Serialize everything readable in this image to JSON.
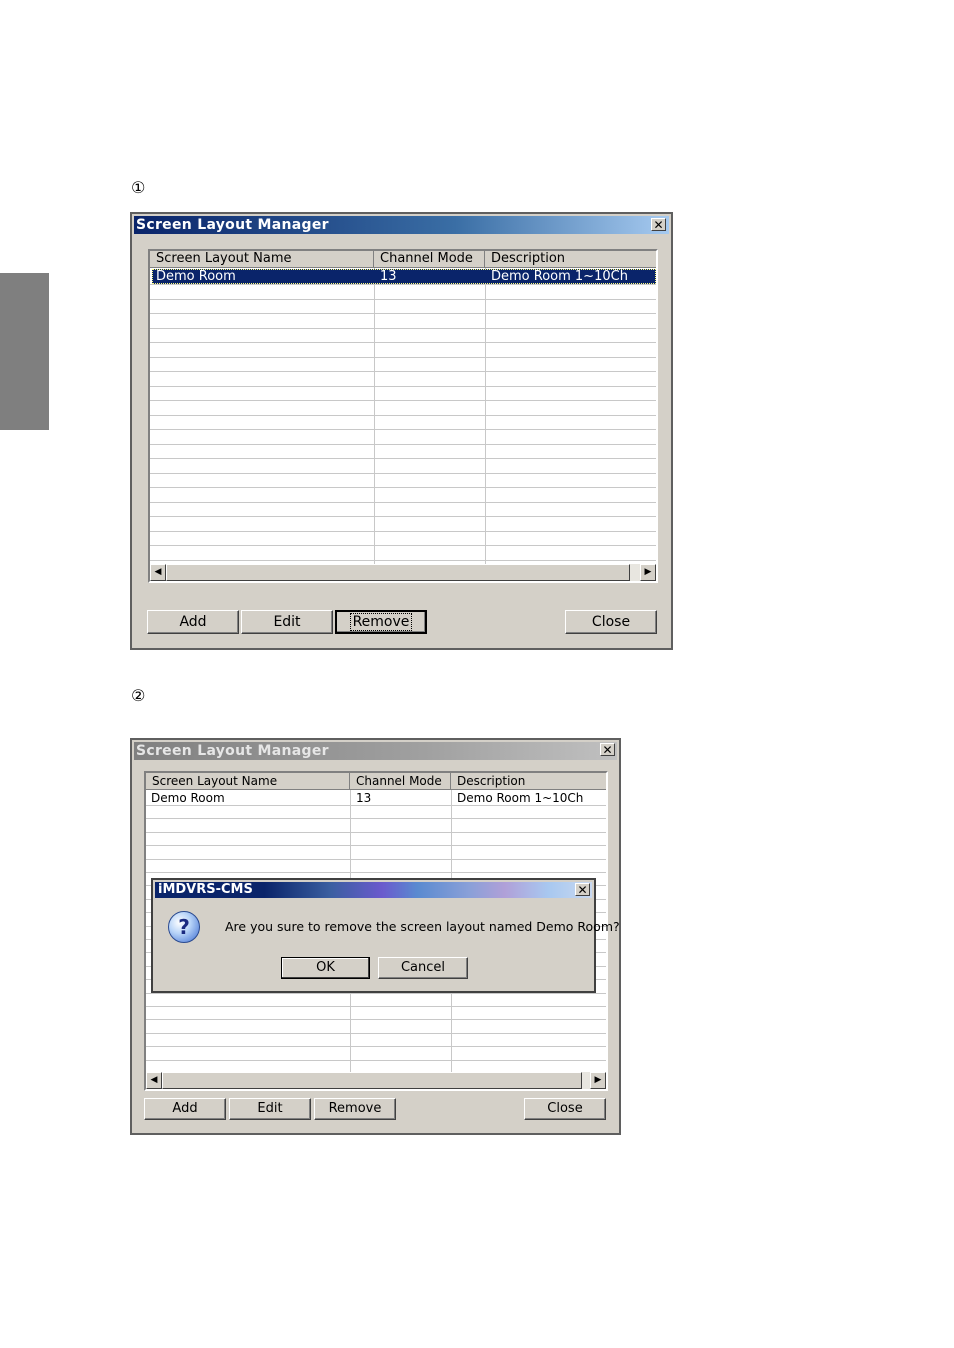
{
  "steps": {
    "step1": "①",
    "step2": "②"
  },
  "window1": {
    "title": "Screen Layout Manager",
    "columns": [
      "Screen Layout Name",
      "Channel Mode",
      "Description"
    ],
    "rows": [
      {
        "name": "Demo Room",
        "mode": "13",
        "desc": "Demo Room 1~10Ch",
        "selected": true
      }
    ],
    "buttons": {
      "add": "Add",
      "edit": "Edit",
      "remove": "Remove",
      "close": "Close"
    },
    "close_glyph": "✕"
  },
  "window2": {
    "title": "Screen Layout Manager",
    "columns": [
      "Screen Layout Name",
      "Channel Mode",
      "Description"
    ],
    "rows": [
      {
        "name": "Demo Room",
        "mode": "13",
        "desc": "Demo Room 1~10Ch"
      }
    ],
    "buttons": {
      "add": "Add",
      "edit": "Edit",
      "remove": "Remove",
      "close": "Close"
    },
    "close_glyph": "✕"
  },
  "dialog": {
    "title": "iMDVRS-CMS",
    "message": "Are you sure to remove the screen layout named Demo Room?",
    "ok": "OK",
    "cancel": "Cancel",
    "icon": "question-icon",
    "icon_glyph": "?",
    "close_glyph": "✕"
  },
  "scroll": {
    "left": "◀",
    "right": "▶"
  },
  "colors": {
    "selection": "#0a246a",
    "face": "#d4d0c8",
    "side_tab": "#7f7f7f"
  }
}
